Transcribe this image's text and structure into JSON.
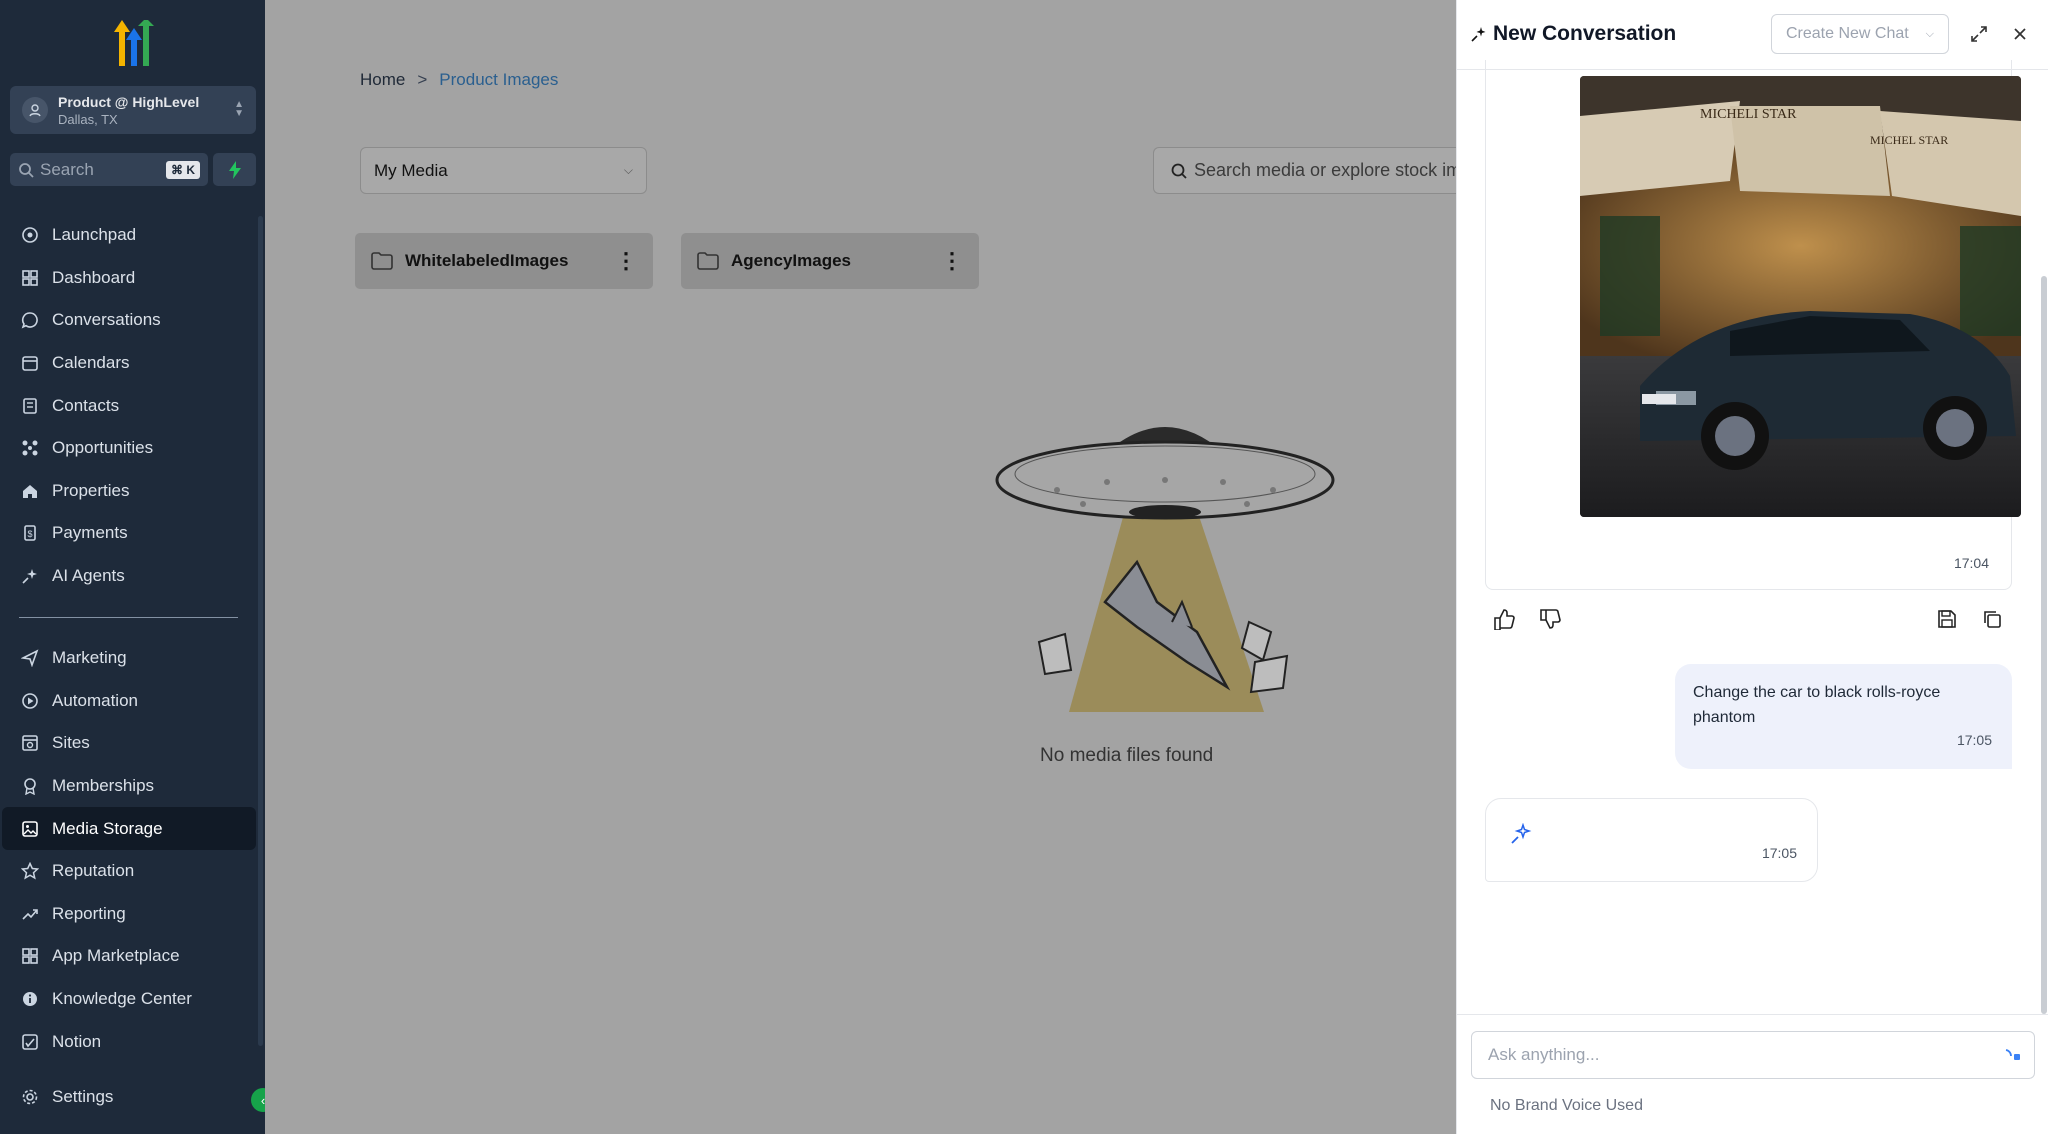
{
  "sidebar": {
    "account": {
      "name": "Product @ HighLevel",
      "location": "Dallas, TX"
    },
    "search": {
      "placeholder": "Search",
      "shortcut": "⌘ K"
    },
    "items": [
      {
        "label": "Launchpad",
        "icon": "launchpad-icon"
      },
      {
        "label": "Dashboard",
        "icon": "dashboard-icon"
      },
      {
        "label": "Conversations",
        "icon": "chat-icon"
      },
      {
        "label": "Calendars",
        "icon": "calendar-icon"
      },
      {
        "label": "Contacts",
        "icon": "contacts-icon"
      },
      {
        "label": "Opportunities",
        "icon": "opportunities-icon"
      },
      {
        "label": "Properties",
        "icon": "home-icon"
      },
      {
        "label": "Payments",
        "icon": "payments-icon"
      },
      {
        "label": "AI Agents",
        "icon": "sparkle-icon"
      }
    ],
    "items2": [
      {
        "label": "Marketing",
        "icon": "send-icon"
      },
      {
        "label": "Automation",
        "icon": "automation-icon"
      },
      {
        "label": "Sites",
        "icon": "sites-icon"
      },
      {
        "label": "Memberships",
        "icon": "memberships-icon"
      },
      {
        "label": "Media Storage",
        "icon": "image-icon",
        "active": true
      },
      {
        "label": "Reputation",
        "icon": "star-icon"
      },
      {
        "label": "Reporting",
        "icon": "trend-icon"
      },
      {
        "label": "App Marketplace",
        "icon": "grid-icon"
      },
      {
        "label": "Knowledge Center",
        "icon": "info-icon"
      },
      {
        "label": "Notion",
        "icon": "notion-icon"
      }
    ],
    "settings": "Settings",
    "colors": {
      "bg": "#1e2a3a",
      "accent": "#16a34a"
    }
  },
  "main": {
    "breadcrumb": {
      "home": "Home",
      "sep": ">",
      "current": "Product Images"
    },
    "dropdown": {
      "value": "My Media"
    },
    "search": {
      "placeholder": "Search media or explore stock im"
    },
    "folders": [
      {
        "name": "WhitelabeledImages"
      },
      {
        "name": "AgencyImages"
      }
    ],
    "empty_text": "No media files found"
  },
  "panel": {
    "title": "New Conversation",
    "new_chat": "Create New Chat",
    "image_time": "17:04",
    "image_sign_1": "MICHELI STAR",
    "image_sign_2": "MICHEL STAR",
    "user_message": {
      "text": "Change the car to black rolls-royce phantom",
      "time": "17:05"
    },
    "assistant_message": {
      "time": "17:05"
    },
    "input": {
      "placeholder": "Ask anything..."
    },
    "brand_voice": "No Brand Voice Used"
  }
}
